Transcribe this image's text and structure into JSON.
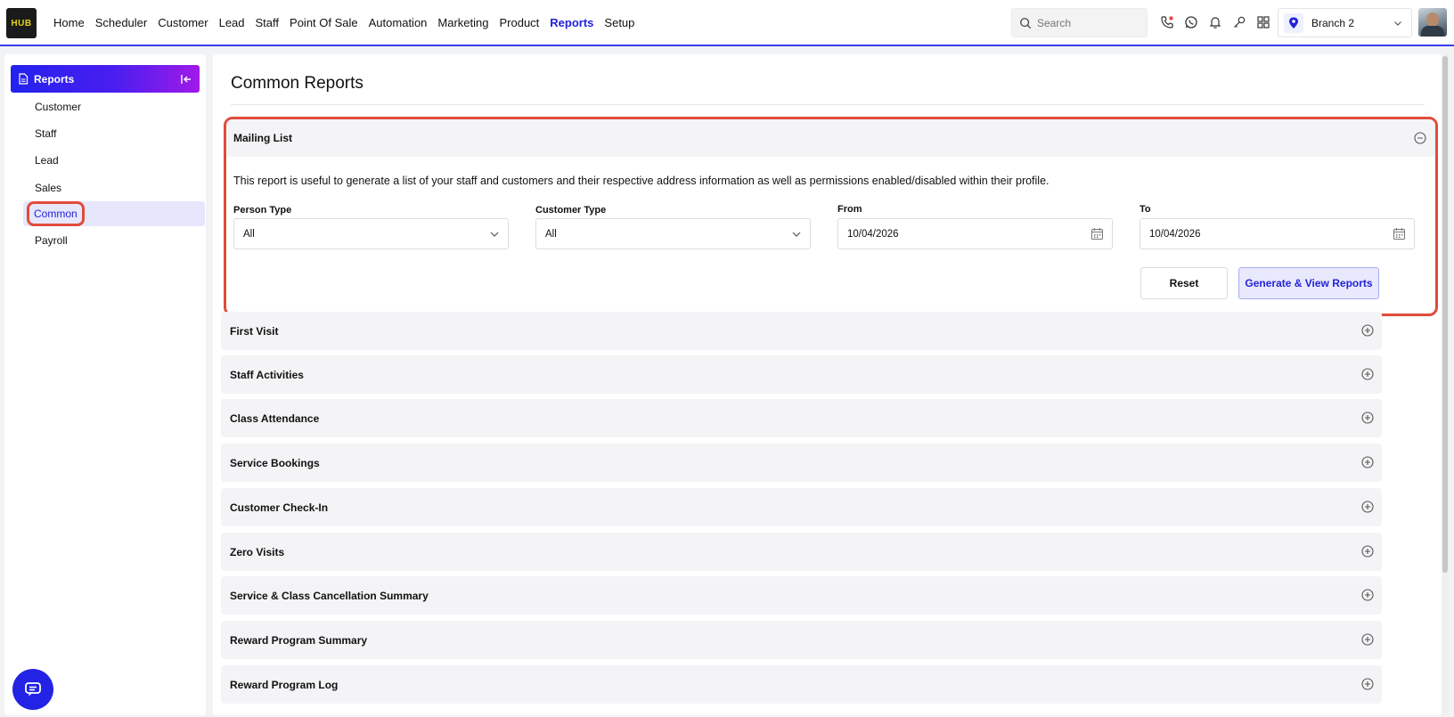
{
  "app": {
    "logo_text": "HUB"
  },
  "nav": {
    "items": [
      {
        "label": "Home"
      },
      {
        "label": "Scheduler"
      },
      {
        "label": "Customer"
      },
      {
        "label": "Lead"
      },
      {
        "label": "Staff"
      },
      {
        "label": "Point Of Sale"
      },
      {
        "label": "Automation"
      },
      {
        "label": "Marketing"
      },
      {
        "label": "Product"
      },
      {
        "label": "Reports"
      },
      {
        "label": "Setup"
      }
    ],
    "active": "Reports"
  },
  "search": {
    "placeholder": "Search"
  },
  "top_icons": [
    "phone-icon",
    "whatsapp-icon",
    "bell-icon",
    "key-icon",
    "apps-grid-icon"
  ],
  "branch": {
    "label": "Branch 2"
  },
  "sidebar": {
    "title": "Reports",
    "items": [
      {
        "label": "Customer"
      },
      {
        "label": "Staff"
      },
      {
        "label": "Lead"
      },
      {
        "label": "Sales"
      },
      {
        "label": "Common"
      },
      {
        "label": "Payroll"
      }
    ],
    "active": "Common"
  },
  "main": {
    "title": "Common Reports",
    "mailing": {
      "title": "Mailing List",
      "description": "This report is useful to generate a list of your staff and customers and their respective address information as well as permissions enabled/disabled within their profile.",
      "person_type": {
        "label": "Person Type",
        "value": "All"
      },
      "customer_type": {
        "label": "Customer Type",
        "value": "All"
      },
      "from": {
        "label": "From",
        "value": "10/04/2026"
      },
      "to": {
        "label": "To",
        "value": "10/04/2026"
      },
      "reset_label": "Reset",
      "generate_label": "Generate & View Reports"
    },
    "sections": [
      {
        "title": "First Visit"
      },
      {
        "title": "Staff Activities"
      },
      {
        "title": "Class Attendance"
      },
      {
        "title": "Service Bookings"
      },
      {
        "title": "Customer Check-In"
      },
      {
        "title": "Zero Visits"
      },
      {
        "title": "Service & Class Cancellation Summary"
      },
      {
        "title": "Reward Program Summary"
      },
      {
        "title": "Reward Program Log"
      }
    ]
  },
  "colors": {
    "accent": "#2323d6",
    "highlight": "#e14b3c",
    "panel": "#f4f4f6"
  }
}
